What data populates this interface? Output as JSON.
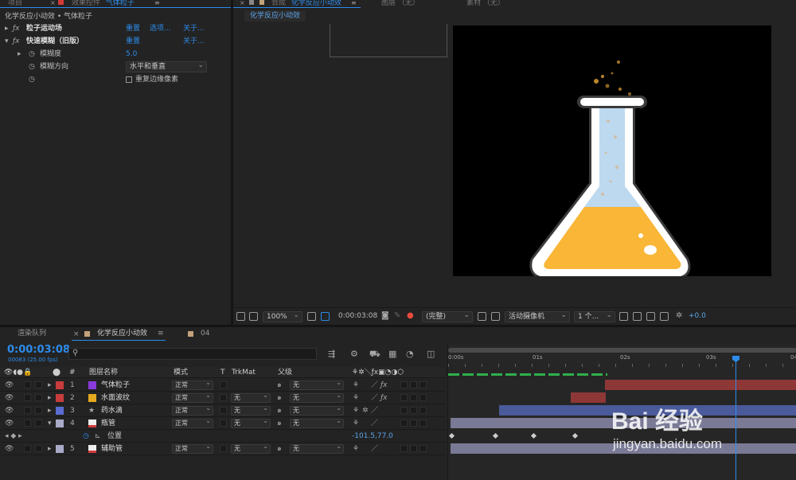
{
  "top_tabs": {
    "project": "项目",
    "effect_controls": "效果控件",
    "effect_controls_target": "气体粒子",
    "composition_prefix": "合成",
    "composition_name": "化学反应小动效",
    "layer": "图层 （无）",
    "footage": "素材 （无）"
  },
  "effects_panel": {
    "breadcrumb": "化学反应小动效 • 气体粒子",
    "effects": [
      {
        "name": "粒子运动场",
        "reset": "重置",
        "options": "选项...",
        "about": "关于..."
      },
      {
        "name": "快速模糊（旧版）",
        "reset": "重置",
        "about": "关于..."
      }
    ],
    "blurriness_label": "模糊度",
    "blurriness_value": "5.0",
    "blur_dimensions_label": "模糊方向",
    "blur_dimensions_value": "水平和垂直",
    "repeat_edge_label": "重复边缘像素"
  },
  "viewer": {
    "comp_tab": "化学反应小动效",
    "zoom": "100%",
    "timecode": "0:00:03:08",
    "resolution": "(完整)",
    "camera": "活动摄像机",
    "views": "1 个...",
    "exposure": "+0.0"
  },
  "timeline": {
    "render_queue_tab": "渲染队列",
    "comp_tab": "化学反应小动效",
    "comp_tab2": "04",
    "current_time": "0:00:03:08",
    "frame_info": "00083 (25.00 fps)",
    "search_placeholder": "",
    "columns": {
      "hash": "#",
      "layer_name": "图层名称",
      "mode": "模式",
      "t": "T",
      "trkmat": "TrkMat",
      "parent": "父级"
    },
    "ruler": [
      "0:00s",
      "01s",
      "02s",
      "03s",
      "04"
    ],
    "layers": [
      {
        "num": "1",
        "name": "气体粒子",
        "mode": "正常",
        "trkmat": "",
        "parent": "无",
        "color": "#8a3bdc"
      },
      {
        "num": "2",
        "name": "水面波纹",
        "mode": "正常",
        "trkmat": "无",
        "parent": "无",
        "color": "#e6a81e"
      },
      {
        "num": "3",
        "name": "药水滴",
        "mode": "正常",
        "trkmat": "无",
        "parent": "无",
        "color": "#5a6bd1"
      },
      {
        "num": "4",
        "name": "瓶管",
        "mode": "正常",
        "trkmat": "无",
        "parent": "无",
        "color": "#a9a9c8"
      },
      {
        "num": "5",
        "name": "辅助管",
        "mode": "正常",
        "trkmat": "无",
        "parent": "无",
        "color": "#a9a9c8"
      }
    ],
    "position_label": "位置",
    "position_value": "-101.5,77.0"
  },
  "watermark": {
    "brand": "Bai 经验",
    "url": "jingyan.baidu.com"
  },
  "colors": {
    "accent": "#2d8ceb",
    "flask_liquid": "#f9b637",
    "flask_tube": "#bcd9ef"
  }
}
